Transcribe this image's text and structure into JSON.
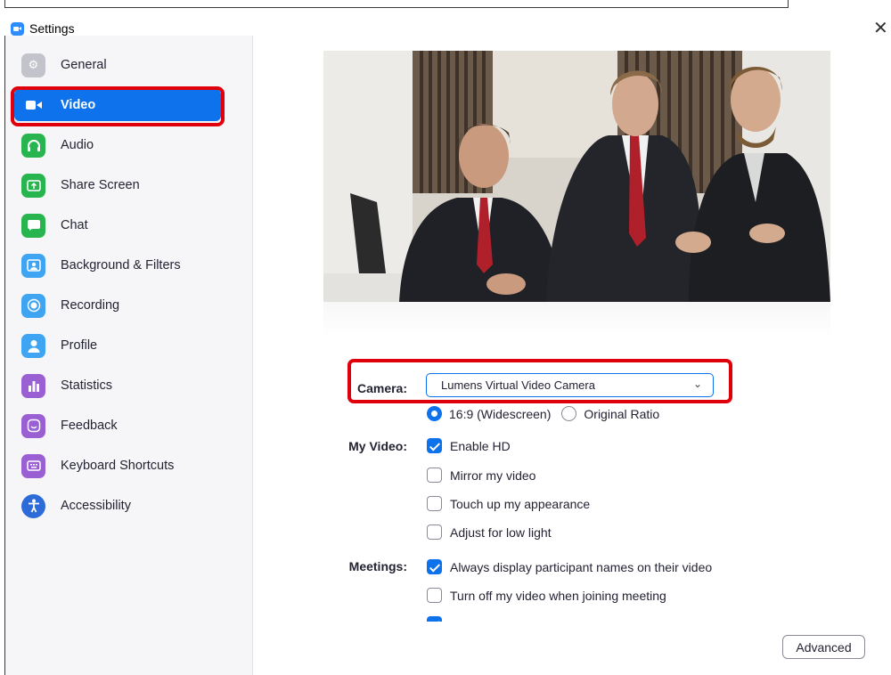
{
  "window": {
    "title": "Settings",
    "close_glyph": "✕"
  },
  "sidebar": {
    "items": [
      {
        "label": "General",
        "icon": "gear-icon",
        "color": "#c3c3cb"
      },
      {
        "label": "Video",
        "icon": "video-camera-icon",
        "color": "#0e72ed",
        "active": true
      },
      {
        "label": "Audio",
        "icon": "headphones-icon",
        "color": "#28b550"
      },
      {
        "label": "Share Screen",
        "icon": "share-screen-icon",
        "color": "#28b550"
      },
      {
        "label": "Chat",
        "icon": "chat-bubble-icon",
        "color": "#28b550"
      },
      {
        "label": "Background & Filters",
        "icon": "person-background-icon",
        "color": "#3fa4f2"
      },
      {
        "label": "Recording",
        "icon": "record-icon",
        "color": "#3fa4f2"
      },
      {
        "label": "Profile",
        "icon": "person-icon",
        "color": "#3fa4f2"
      },
      {
        "label": "Statistics",
        "icon": "bar-chart-icon",
        "color": "#9a5fd3"
      },
      {
        "label": "Feedback",
        "icon": "smiley-icon",
        "color": "#9a5fd3"
      },
      {
        "label": "Keyboard Shortcuts",
        "icon": "keyboard-icon",
        "color": "#9a5fd3"
      },
      {
        "label": "Accessibility",
        "icon": "accessibility-icon",
        "color": "#2d6cd8"
      }
    ]
  },
  "video": {
    "camera_label": "Camera:",
    "camera_value": "Lumens Virtual Video Camera",
    "ratio_options": [
      {
        "label": "16:9 (Widescreen)",
        "selected": true
      },
      {
        "label": "Original Ratio",
        "selected": false
      }
    ],
    "my_video_label": "My Video:",
    "my_video_options": [
      {
        "label": "Enable HD",
        "checked": true
      },
      {
        "label": "Mirror my video",
        "checked": false
      },
      {
        "label": "Touch up my appearance",
        "checked": false
      },
      {
        "label": "Adjust for low light",
        "checked": false
      }
    ],
    "meetings_label": "Meetings:",
    "meetings_options": [
      {
        "label": "Always display participant names on their video",
        "checked": true
      },
      {
        "label": "Turn off my video when joining meeting",
        "checked": false
      }
    ],
    "advanced_label": "Advanced"
  },
  "colors": {
    "accent": "#0e72ed",
    "highlight": "#e0000b"
  }
}
